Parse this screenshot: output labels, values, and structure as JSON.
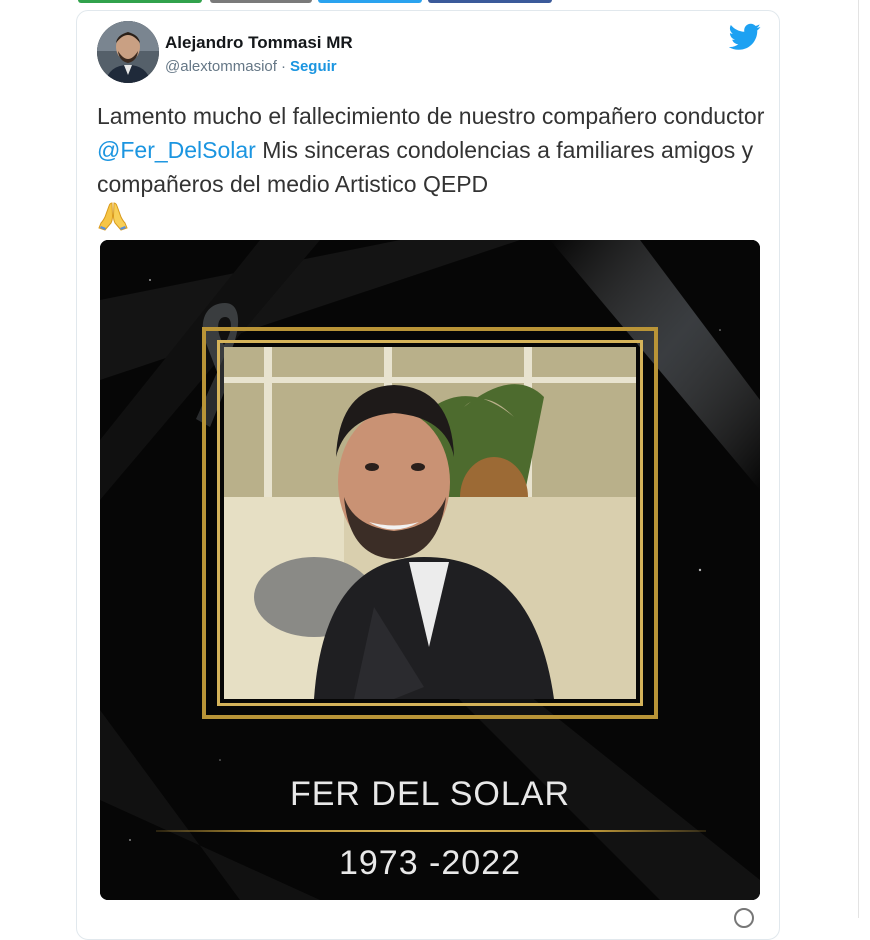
{
  "tweet": {
    "author_name": "Alejandro Tommasi MR",
    "handle": "@alextommasiof",
    "separator": "·",
    "follow_label": "Seguir",
    "text_parts": {
      "before_mention": "Lamento mucho el fallecimiento de nuestro compañero conductor ",
      "mention": "@Fer_DelSolar",
      "after_mention": " Mis sinceras condolencias a familiares amigos y compañeros del medio Artistico QEPD"
    },
    "emoji_icon": "folded-hands-icon"
  },
  "media": {
    "memorial_name": "FER DEL SOLAR",
    "memorial_years": "1973 -2022"
  },
  "icons": {
    "brand": "twitter-bird-icon",
    "ribbon": "mourning-ribbon-icon"
  },
  "colors": {
    "link": "#1b95e0",
    "twitter_blue": "#1da1f2",
    "gold": "#b99437",
    "text": "#333333"
  }
}
